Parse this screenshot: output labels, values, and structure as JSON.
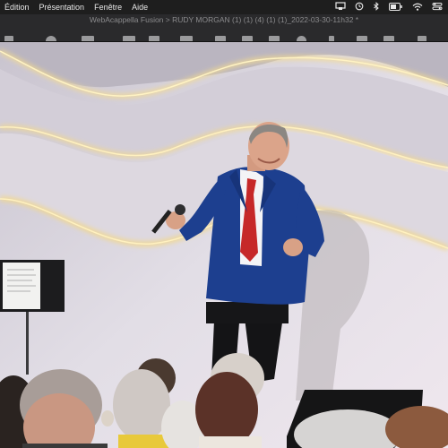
{
  "menubar": {
    "items": [
      {
        "label": "Édition"
      },
      {
        "label": "Présentation"
      },
      {
        "label": "Fenêtre"
      },
      {
        "label": "Aide"
      }
    ]
  },
  "window": {
    "title": "WebAcappella Fusion > RUDY MORGAN (1) (1) (4) (1) (1)_2022-03-30-11h32 *"
  },
  "colors": {
    "menubar_bg": "#1e1e1e",
    "titlebar_bg": "#2a2a2c",
    "jacket": "#1d3f8f",
    "tie": "#c62828",
    "led": "#f3d889"
  },
  "video": {
    "content": "stage-performance-frame"
  }
}
